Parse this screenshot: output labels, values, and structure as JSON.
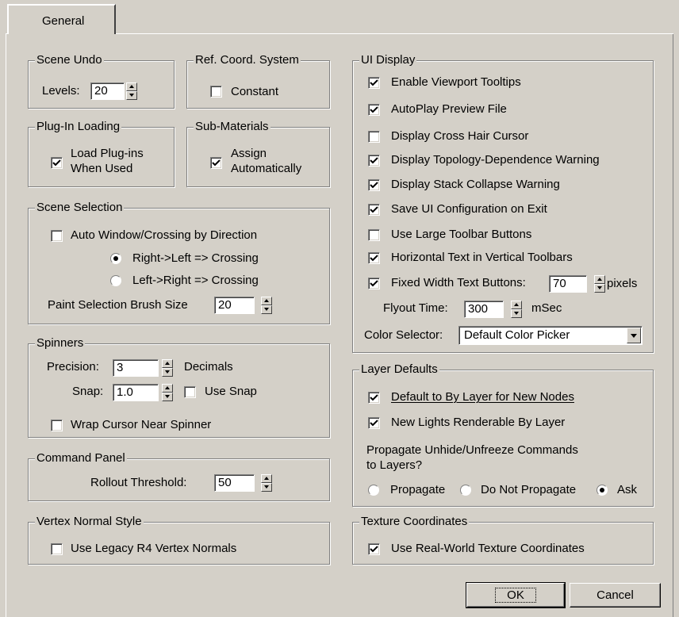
{
  "tab": {
    "label": "General"
  },
  "scene_undo": {
    "title": "Scene Undo",
    "levels_label": "Levels:",
    "levels_value": "20"
  },
  "ref_coord": {
    "title": "Ref. Coord. System",
    "constant_label": "Constant",
    "constant_checked": false
  },
  "plugin_loading": {
    "title": "Plug-In Loading",
    "label_line1": "Load Plug-ins",
    "label_line2": "When Used",
    "checked": true
  },
  "sub_materials": {
    "title": "Sub-Materials",
    "label_line1": "Assign",
    "label_line2": "Automatically",
    "checked": true
  },
  "scene_selection": {
    "title": "Scene Selection",
    "auto_window_label": "Auto Window/Crossing by Direction",
    "auto_window_checked": false,
    "radio_right_left": "Right->Left => Crossing",
    "radio_left_right": "Left->Right => Crossing",
    "selected": "right_left",
    "brush_label": "Paint Selection Brush Size",
    "brush_value": "20"
  },
  "spinners": {
    "title": "Spinners",
    "precision_label": "Precision:",
    "precision_value": "3",
    "decimals_label": "Decimals",
    "snap_label": "Snap:",
    "snap_value": "1.0",
    "use_snap_label": "Use Snap",
    "use_snap_checked": false,
    "wrap_label": "Wrap Cursor Near Spinner",
    "wrap_checked": false
  },
  "command_panel": {
    "title": "Command Panel",
    "rollout_label": "Rollout Threshold:",
    "rollout_value": "50"
  },
  "vertex_normal": {
    "title": "Vertex Normal Style",
    "legacy_label": "Use Legacy R4 Vertex Normals",
    "legacy_checked": false
  },
  "ui_display": {
    "title": "UI Display",
    "options": [
      {
        "label": "Enable Viewport Tooltips",
        "checked": true
      },
      {
        "label": "AutoPlay Preview File",
        "checked": true
      },
      {
        "label": "Display Cross Hair Cursor",
        "checked": false
      },
      {
        "label": "Display Topology-Dependence Warning",
        "checked": true
      },
      {
        "label": "Display Stack Collapse Warning",
        "checked": true
      },
      {
        "label": "Save UI Configuration on Exit",
        "checked": true
      },
      {
        "label": "Use Large Toolbar Buttons",
        "checked": false
      },
      {
        "label": "Horizontal Text in Vertical Toolbars",
        "checked": true
      },
      {
        "label": "Fixed Width Text Buttons:",
        "checked": true
      }
    ],
    "fixed_width_value": "70",
    "pixels_label": "pixels",
    "flyout_label": "Flyout Time:",
    "flyout_value": "300",
    "msec_label": "mSec",
    "color_selector_label": "Color Selector:",
    "color_selector_value": "Default Color Picker"
  },
  "layer_defaults": {
    "title": "Layer Defaults",
    "default_bylayer_label": "Default to By Layer for New Nodes",
    "default_bylayer_checked": true,
    "lights_label": "New Lights Renderable By Layer",
    "lights_checked": true,
    "propagate_line1": "Propagate Unhide/Unfreeze Commands",
    "propagate_line2": "to Layers?",
    "radio_propagate": "Propagate",
    "radio_do_not": "Do Not Propagate",
    "radio_ask": "Ask",
    "selected": "ask"
  },
  "texture_coords": {
    "title": "Texture Coordinates",
    "real_world_label": "Use Real-World Texture Coordinates",
    "real_world_checked": true
  },
  "buttons": {
    "ok": "OK",
    "cancel": "Cancel"
  }
}
